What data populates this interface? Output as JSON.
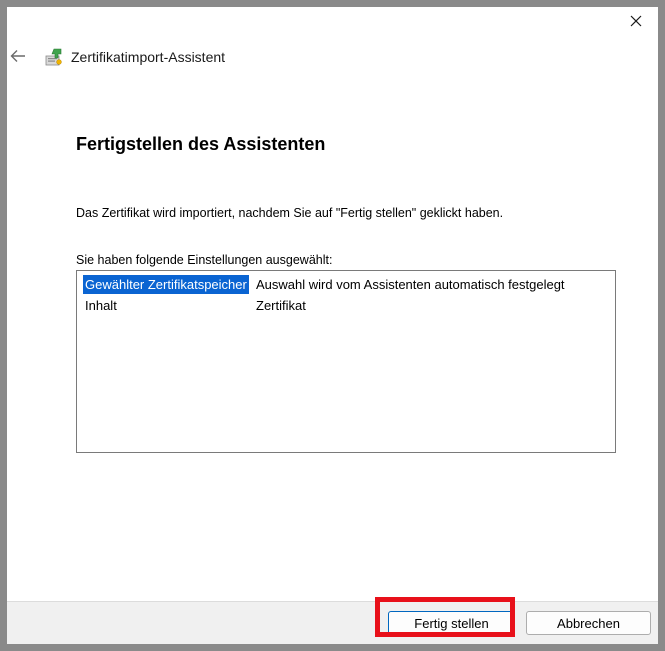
{
  "window": {
    "title": "Zertifikatimport-Assistent"
  },
  "page": {
    "heading": "Fertigstellen des Assistenten",
    "description": "Das Zertifikat wird importiert, nachdem Sie auf \"Fertig stellen\" geklickt haben.",
    "list_label": "Sie haben folgende Einstellungen ausgewählt:"
  },
  "settings": {
    "rows": [
      {
        "key": "Gewählter Zertifikatspeicher",
        "value": "Auswahl wird vom Assistenten automatisch festgelegt",
        "selected": true
      },
      {
        "key": "Inhalt",
        "value": "Zertifikat",
        "selected": false
      }
    ]
  },
  "footer": {
    "finish_label": "Fertig stellen",
    "cancel_label": "Abbrechen"
  },
  "colors": {
    "selection": "#0a64d2",
    "highlight": "#e8101a",
    "footer_bg": "#f0f0f0"
  }
}
